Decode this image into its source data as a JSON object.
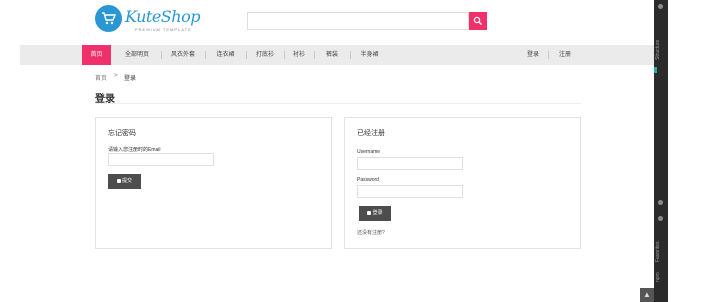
{
  "header": {
    "logo_text": "KuteShop",
    "logo_sub": "PREMIUM TEMPLATE",
    "search_placeholder": ""
  },
  "nav": {
    "items": [
      {
        "label": "首页",
        "active": true
      },
      {
        "label": "全部明页",
        "active": false
      },
      {
        "label": "风衣外套",
        "active": false
      },
      {
        "label": "连衣裙",
        "active": false
      },
      {
        "label": "打底衫",
        "active": false
      },
      {
        "label": "衬衫",
        "active": false
      },
      {
        "label": "裤装",
        "active": false
      },
      {
        "label": "半身裙",
        "active": false
      }
    ],
    "login": "登录",
    "register": "注册"
  },
  "breadcrumb": {
    "home": "首页",
    "separator": ">",
    "current": "登录"
  },
  "page_title": "登录",
  "forgot": {
    "heading": "忘记密码",
    "label": "请输入您注册时的Email",
    "email_value": "",
    "button": "提交"
  },
  "login": {
    "heading": "已经注册",
    "username_label": "Username",
    "username_value": "",
    "password_label": "Password",
    "password_value": "",
    "button": "登录",
    "no_account_link": "还没有注册?"
  },
  "side_panel": {
    "top_label": "Structure",
    "bottom_label": "Favorites",
    "bottom_label2": "npm"
  },
  "colors": {
    "accent": "#f0306a",
    "logo": "#2a97d4",
    "dark_button": "#4d4d4d",
    "nav_bg": "#ebebeb"
  }
}
